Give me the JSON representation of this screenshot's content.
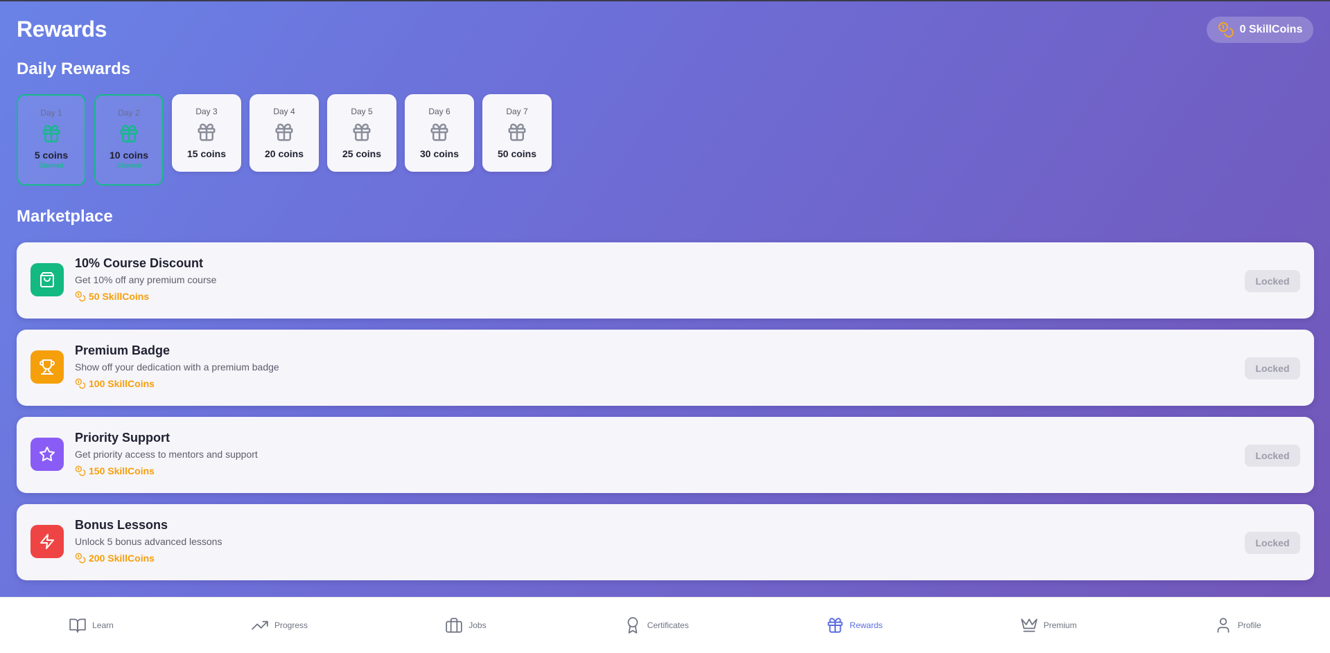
{
  "header": {
    "title": "Rewards",
    "coin_balance": "0 SkillCoins"
  },
  "daily": {
    "section_title": "Daily Rewards",
    "days": [
      {
        "label": "Day 1",
        "coins": "5 coins",
        "status": "Claimed",
        "claimed": true
      },
      {
        "label": "Day 2",
        "coins": "10 coins",
        "status": "Claimed",
        "claimed": true
      },
      {
        "label": "Day 3",
        "coins": "15 coins",
        "claimed": false
      },
      {
        "label": "Day 4",
        "coins": "20 coins",
        "claimed": false
      },
      {
        "label": "Day 5",
        "coins": "25 coins",
        "claimed": false
      },
      {
        "label": "Day 6",
        "coins": "30 coins",
        "claimed": false
      },
      {
        "label": "Day 7",
        "coins": "50 coins",
        "claimed": false
      }
    ]
  },
  "marketplace": {
    "section_title": "Marketplace",
    "items": [
      {
        "title": "10% Course Discount",
        "description": "Get 10% off any premium course",
        "cost": "50 SkillCoins",
        "button": "Locked",
        "icon": "shopping-bag-icon",
        "color": "#13b981"
      },
      {
        "title": "Premium Badge",
        "description": "Show off your dedication with a premium badge",
        "cost": "100 SkillCoins",
        "button": "Locked",
        "icon": "trophy-icon",
        "color": "#f59f0a"
      },
      {
        "title": "Priority Support",
        "description": "Get priority access to mentors and support",
        "cost": "150 SkillCoins",
        "button": "Locked",
        "icon": "star-icon",
        "color": "#8a5cf6"
      },
      {
        "title": "Bonus Lessons",
        "description": "Unlock 5 bonus advanced lessons",
        "cost": "200 SkillCoins",
        "button": "Locked",
        "icon": "lightning-icon",
        "color": "#ef4444"
      }
    ]
  },
  "nav": {
    "items": [
      {
        "label": "Learn",
        "icon": "book-icon"
      },
      {
        "label": "Progress",
        "icon": "trending-up-icon"
      },
      {
        "label": "Jobs",
        "icon": "briefcase-icon"
      },
      {
        "label": "Certificates",
        "icon": "award-icon"
      },
      {
        "label": "Rewards",
        "icon": "gift-icon",
        "active": true
      },
      {
        "label": "Premium",
        "icon": "crown-icon"
      },
      {
        "label": "Profile",
        "icon": "user-icon"
      }
    ]
  },
  "colors": {
    "accent": "#5a6de0",
    "claimed": "#16b98a",
    "coin": "#f59f0a"
  }
}
